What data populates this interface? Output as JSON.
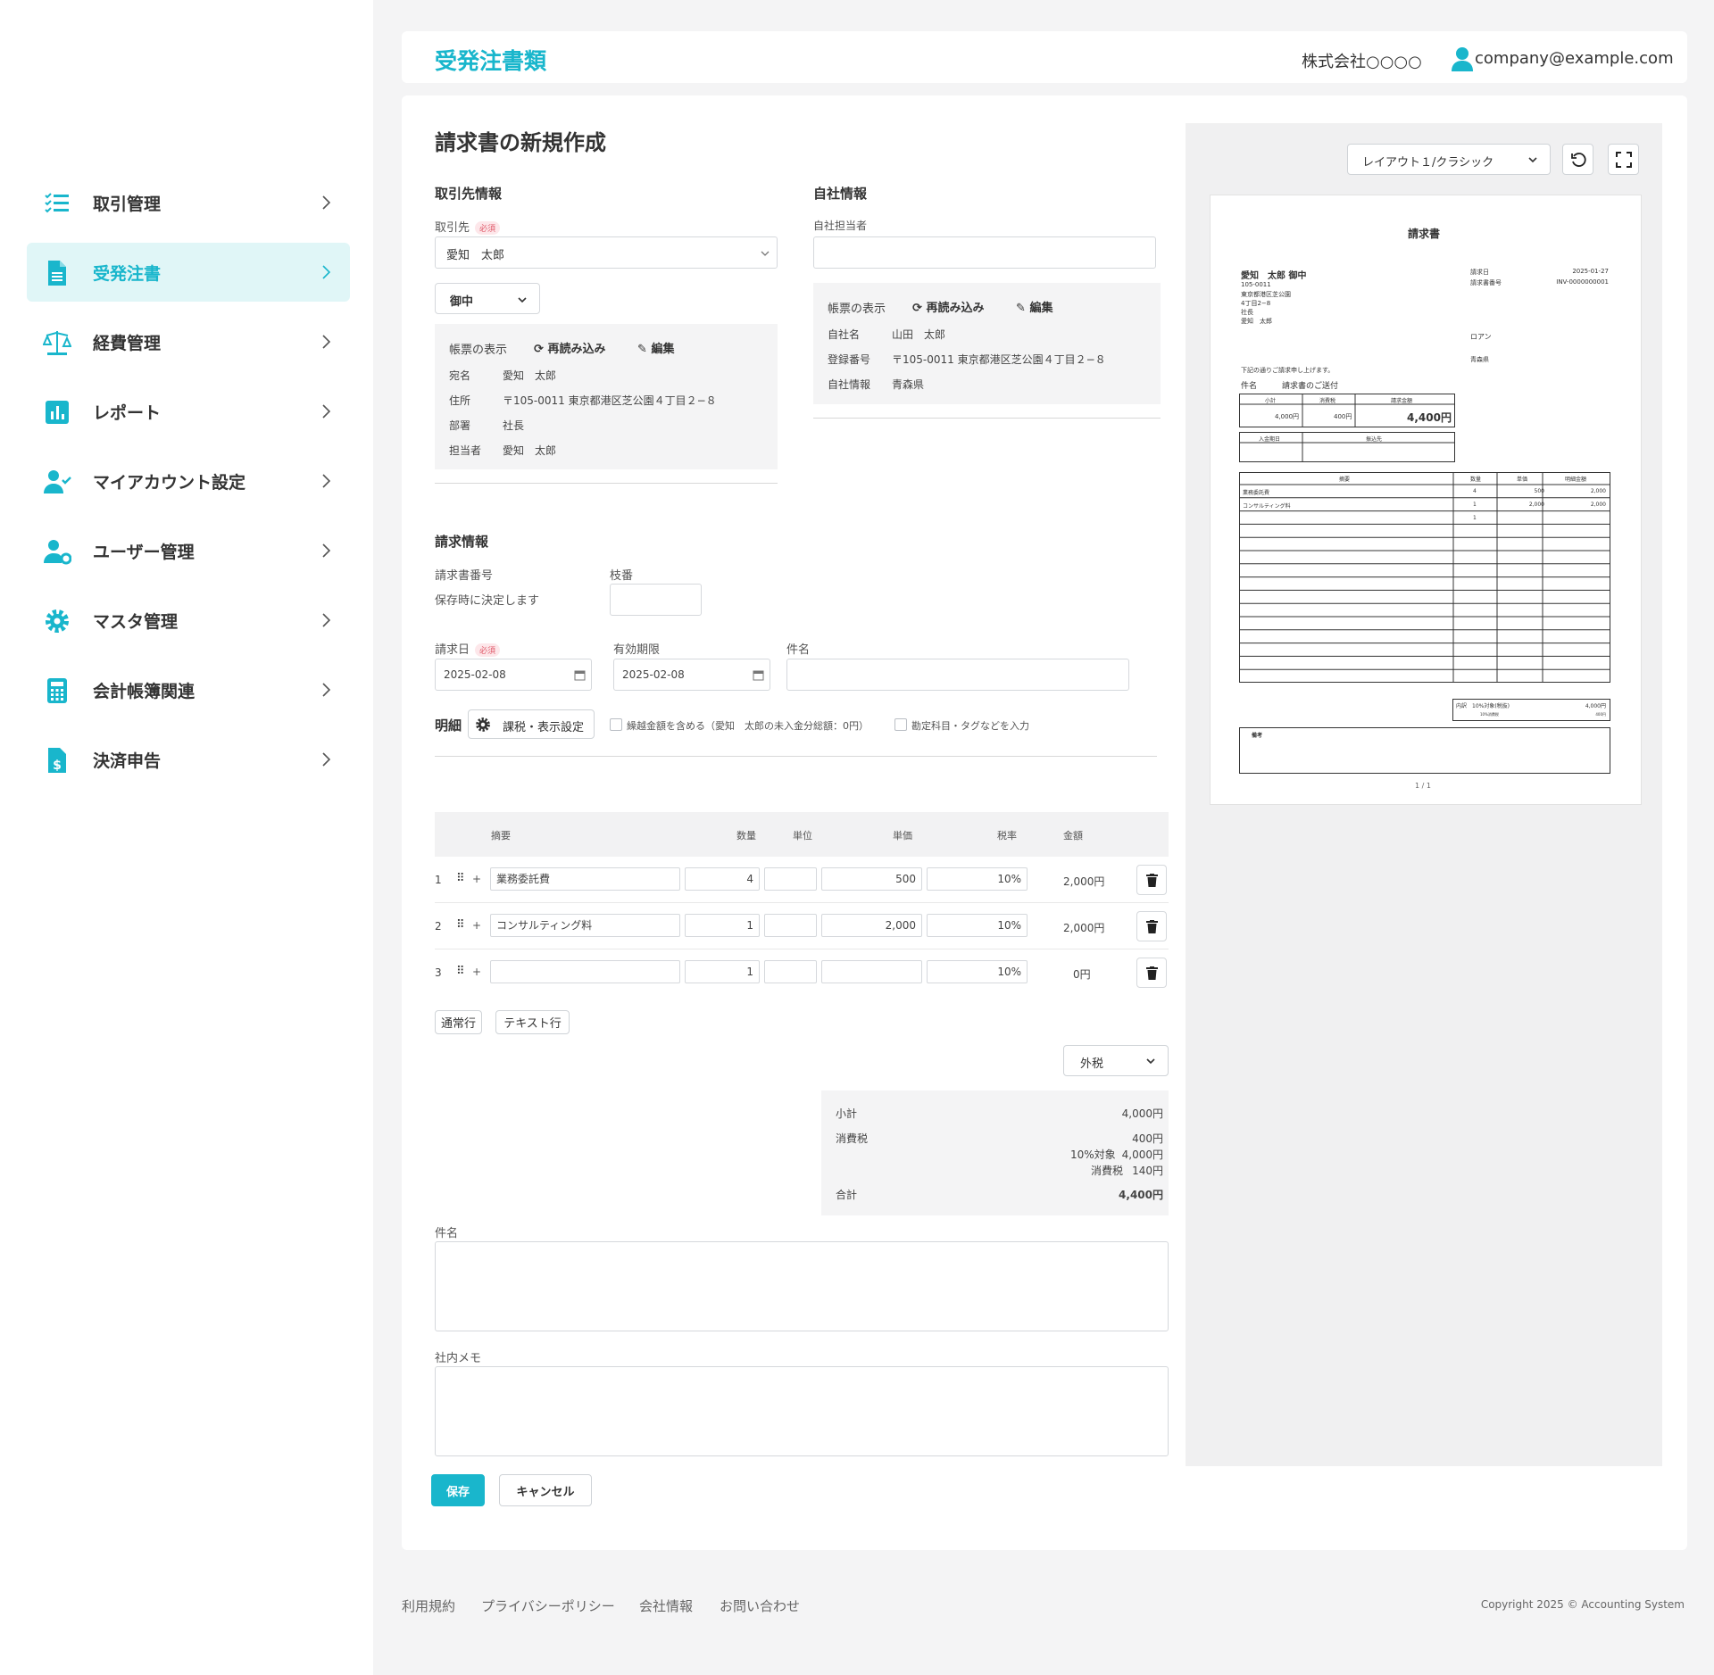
{
  "sidebar": {
    "items": [
      {
        "label": "取引管理",
        "icon": "checklist-icon"
      },
      {
        "label": "受発注書",
        "icon": "document-icon",
        "active": true
      },
      {
        "label": "経費管理",
        "icon": "balance-scale-icon"
      },
      {
        "label": "レポート",
        "icon": "bar-chart-icon"
      },
      {
        "label": "マイアカウント設定",
        "icon": "user-check-icon"
      },
      {
        "label": "ユーザー管理",
        "icon": "user-gear-icon"
      },
      {
        "label": "マスタ管理",
        "icon": "gear-icon"
      },
      {
        "label": "会計帳簿関連",
        "icon": "calculator-icon"
      },
      {
        "label": "決済申告",
        "icon": "dollar-document-icon"
      }
    ]
  },
  "header": {
    "title": "受発注書類",
    "company": "株式会社○○○○",
    "user_email": "company@example.com"
  },
  "form": {
    "title": "請求書の新規作成",
    "client_section": {
      "heading": "取引先情報",
      "client_label": "取引先",
      "required_badge": "必須",
      "client_value": "愛知　太郎",
      "honorific": "御中",
      "display_label": "帳票の表示",
      "reload_label": "再読み込み",
      "edit_label": "編集",
      "rows": [
        {
          "label": "宛名",
          "value": "愛知　太郎"
        },
        {
          "label": "住所",
          "value": "〒105-0011 東京都港区芝公園４丁目２−８"
        },
        {
          "label": "部署",
          "value": "社長"
        },
        {
          "label": "担当者",
          "value": "愛知　太郎"
        }
      ]
    },
    "own_section": {
      "heading": "自社情報",
      "staff_label": "自社担当者",
      "staff_value": "",
      "display_label": "帳票の表示",
      "reload_label": "再読み込み",
      "edit_label": "編集",
      "rows": [
        {
          "label": "自社名",
          "value": "山田　太郎"
        },
        {
          "label": "登録番号",
          "value": "〒105-0011 東京都港区芝公園４丁目２−８"
        },
        {
          "label": "自社情報",
          "value": "青森県"
        }
      ]
    },
    "invoice_section": {
      "heading": "請求情報",
      "number_label": "請求書番号",
      "number_note": "保存時に決定します",
      "branch_label": "枝番",
      "branch_value": "",
      "date_label": "請求日",
      "required_badge": "必須",
      "date_value": "2025-02-08",
      "expiry_label": "有効期限",
      "expiry_value": "2025-02-08",
      "subject_label": "件名",
      "subject_value": ""
    },
    "details": {
      "label": "明細",
      "settings_label": "課税・表示設定",
      "carry_over_label": "繰越金額を含める（愛知　太郎の未入金分総額：0円）",
      "account_tag_label": "勘定科目・タグなどを入力",
      "columns": [
        "摘要",
        "数量",
        "単位",
        "単価",
        "税率",
        "金額"
      ],
      "rows": [
        {
          "no": "1",
          "desc": "業務委託費",
          "qty": "4",
          "unit": "",
          "price": "500",
          "tax": "10%",
          "amount": "2,000円"
        },
        {
          "no": "2",
          "desc": "コンサルティング料",
          "qty": "1",
          "unit": "",
          "price": "2,000",
          "tax": "10%",
          "amount": "2,000円"
        },
        {
          "no": "3",
          "desc": "",
          "qty": "1",
          "unit": "",
          "price": "",
          "tax": "10%",
          "amount": "0円"
        }
      ],
      "add_normal_label": "通常行",
      "add_text_label": "テキスト行",
      "tax_mode": "外税"
    },
    "totals": {
      "subtotal_label": "小計",
      "subtotal": "4,000円",
      "tax_label": "消費税",
      "tax": "400円",
      "tax_target_label": "10%対象",
      "tax_target": "4,000円",
      "tax_sub_label": "消費税",
      "tax_sub": "140円",
      "total_label": "合計",
      "total": "4,400円"
    },
    "remarks_label": "件名",
    "remarks_value": "",
    "memo_label": "社内メモ",
    "memo_value": "",
    "save_label": "保存",
    "cancel_label": "キャンセル"
  },
  "preview": {
    "layout_select": "レイアウト１/クラシック",
    "doc_title": "請求書",
    "to_name": "愛知　太郎 御中",
    "to_lines": [
      "105-0011",
      "東京都港区芝公園",
      "4丁目2−8",
      "社長",
      "愛知　太郎"
    ],
    "date_label": "請求日",
    "date_value": "2025-01-27",
    "number_label": "請求書番号",
    "number_value": "INV-0000000001",
    "from_name": "ロアン",
    "from_pref": "青森県",
    "intro": "下記の通りご請求申し上げます。",
    "subject_label": "件名",
    "subject_value": "請求書のご送付",
    "summary_headers": [
      "小計",
      "消費税",
      "請求金額"
    ],
    "summary_values": [
      "4,000円",
      "400円",
      "4,400円"
    ],
    "payment_headers": [
      "入金期日",
      "振込先"
    ],
    "table_headers": [
      "摘要",
      "数量",
      "単価",
      "明細金額"
    ],
    "table_rows": [
      {
        "desc": "業務委託費",
        "qty": "4",
        "price": "500",
        "amount": "2,000"
      },
      {
        "desc": "コンサルティング料",
        "qty": "1",
        "price": "2,000",
        "amount": "2,000"
      },
      {
        "desc": "",
        "qty": "1",
        "price": "",
        "amount": ""
      }
    ],
    "tax_box_label": "内訳　10%対象(税抜)",
    "tax_box_value": "4,000円",
    "tax_box_sub_label": "10%消費税",
    "tax_box_sub_value": "400円",
    "remarks_label": "備考",
    "page_indicator": "1 / 1"
  },
  "footer": {
    "links": [
      "利用規約",
      "プライバシーポリシー",
      "会社情報",
      "お問い合わせ"
    ],
    "copyright": "Copyright 2025 © Accounting System"
  },
  "colors": {
    "accent": "#19b6cc",
    "active_bg": "#e0f6f7",
    "background": "#f4f4f5"
  }
}
